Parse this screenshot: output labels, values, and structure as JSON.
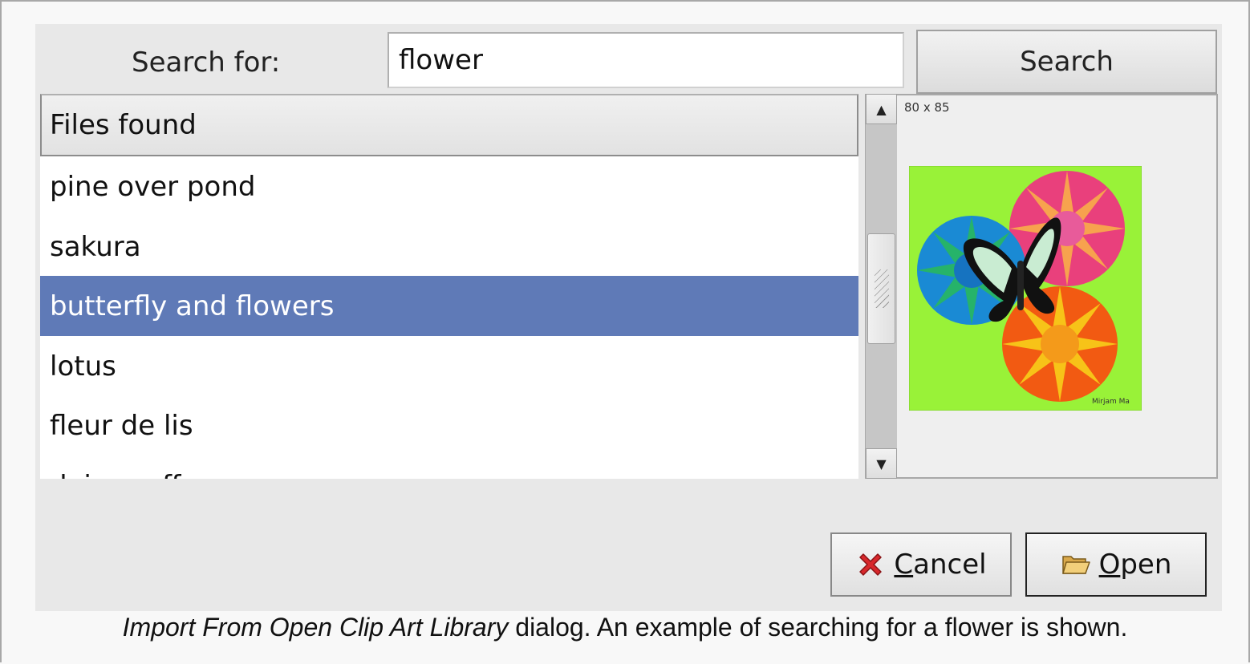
{
  "search": {
    "label": "Search for:",
    "value": "flower",
    "button_label": "Search"
  },
  "files": {
    "header": "Files found",
    "items": [
      {
        "label": "pine over pond",
        "selected": false
      },
      {
        "label": "sakura",
        "selected": false
      },
      {
        "label": "butterfly and flowers",
        "selected": true
      },
      {
        "label": "lotus",
        "selected": false
      },
      {
        "label": "fleur de lis",
        "selected": false
      },
      {
        "label": "daisy caffe",
        "selected": false
      }
    ]
  },
  "preview": {
    "size_text": "80 x 85",
    "signature": "Mirjam Ma",
    "background_color": "#99f238"
  },
  "buttons": {
    "cancel_mnemonic": "C",
    "cancel_rest": "ancel",
    "open_mnemonic": "O",
    "open_rest": "pen"
  },
  "caption": {
    "title": "Import From Open Clip Art Library",
    "text": " dialog. An example of searching for a flower is shown."
  },
  "colors": {
    "selection": "#5f7ab7",
    "dialog_bg": "#e8e8e8"
  },
  "icons": {
    "cancel": "red-x-icon",
    "open": "folder-open-icon",
    "scroll_up": "arrow-up-icon",
    "scroll_down": "arrow-down-icon"
  }
}
